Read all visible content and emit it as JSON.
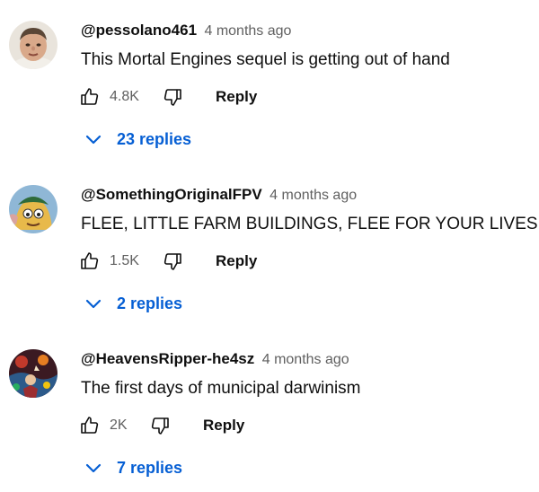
{
  "comments": [
    {
      "author": "@pessolano461",
      "time": "4 months ago",
      "text": "This Mortal Engines sequel is getting out of hand",
      "likes": "4.8K",
      "reply_label": "Reply",
      "replies_label": "23 replies",
      "avatar_icon": "avatar-photo-face"
    },
    {
      "author": "@SomethingOriginalFPV",
      "time": "4 months ago",
      "text": "FLEE, LITTLE FARM BUILDINGS, FLEE FOR YOUR LIVES",
      "likes": "1.5K",
      "reply_label": "Reply",
      "replies_label": "2 replies",
      "avatar_icon": "avatar-cartoon-character"
    },
    {
      "author": "@HeavensRipper-he4sz",
      "time": "4 months ago",
      "text": "The first days of municipal darwinism",
      "likes": "2K",
      "reply_label": "Reply",
      "replies_label": "7 replies",
      "avatar_icon": "avatar-artwork"
    }
  ],
  "colors": {
    "link_blue": "#065fd4",
    "meta_gray": "#606060",
    "text": "#0f0f0f"
  },
  "icons": {
    "like": "thumbs-up-icon",
    "dislike": "thumbs-down-icon",
    "expand": "chevron-down-icon"
  }
}
